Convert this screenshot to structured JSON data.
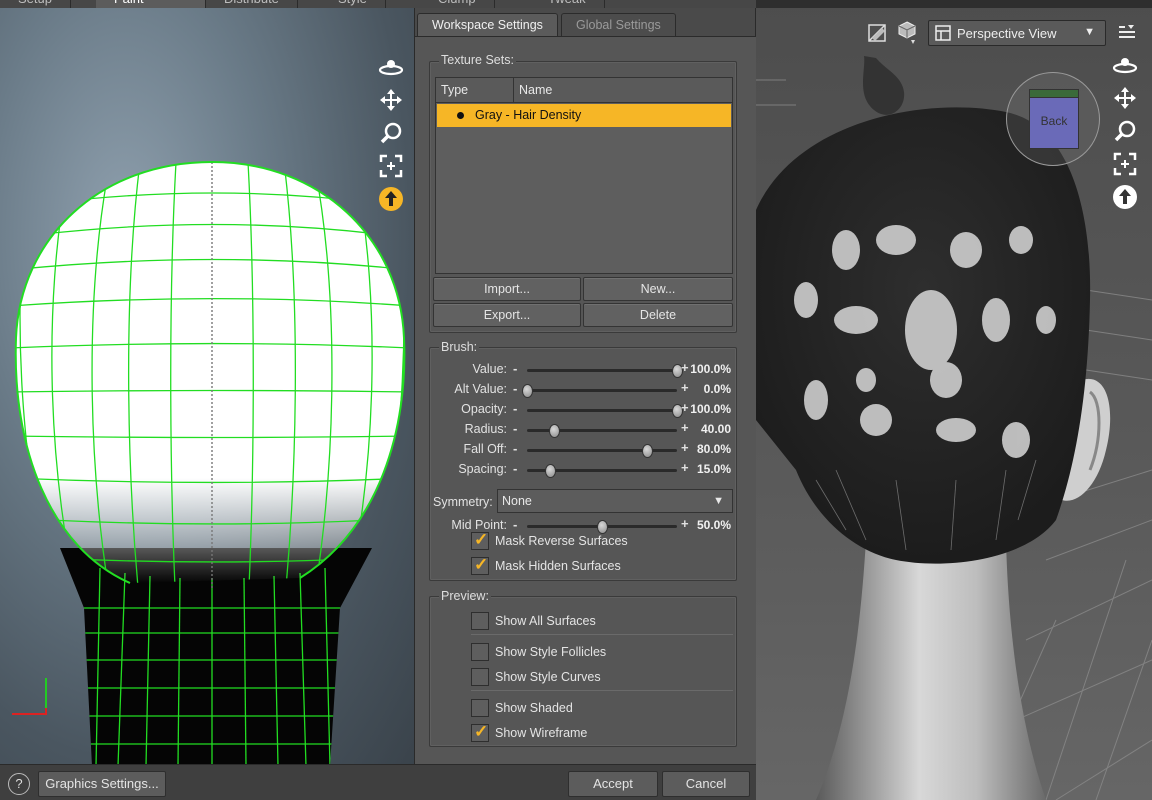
{
  "top_tabs": [
    "Setup",
    "Paint",
    "Distribute",
    "Style",
    "Clump",
    "Tweak"
  ],
  "panel": {
    "tabs": [
      "Workspace Settings",
      "Global Settings"
    ],
    "texture_sets": {
      "title": "Texture Sets:",
      "columns": [
        "Type",
        "Name"
      ],
      "rows": [
        {
          "name": "Gray - Hair Density"
        }
      ],
      "buttons": {
        "import": "Import...",
        "new": "New...",
        "export": "Export...",
        "delete": "Delete"
      }
    },
    "brush": {
      "title": "Brush:",
      "sliders": [
        {
          "label": "Value:",
          "value": "100.0%",
          "position": 1.0
        },
        {
          "label": "Alt Value:",
          "value": "0.0%",
          "position": 0.0
        },
        {
          "label": "Opacity:",
          "value": "100.0%",
          "position": 1.0
        },
        {
          "label": "Radius:",
          "value": "40.00",
          "position": 0.18
        },
        {
          "label": "Fall Off:",
          "value": "80.0%",
          "position": 0.8
        },
        {
          "label": "Spacing:",
          "value": "15.0%",
          "position": 0.15
        }
      ],
      "symmetry_label": "Symmetry:",
      "symmetry_value": "None",
      "midpoint": {
        "label": "Mid Point:",
        "value": "50.0%",
        "position": 0.5
      },
      "mask_reverse": "Mask Reverse Surfaces",
      "mask_hidden": "Mask Hidden Surfaces"
    },
    "preview": {
      "title": "Preview:",
      "show_all": "Show All Surfaces",
      "show_follicles": "Show Style Follicles",
      "show_curves": "Show Style Curves",
      "show_shaded": "Show Shaded",
      "show_wireframe": "Show Wireframe"
    }
  },
  "bottom": {
    "help": "?",
    "graphics": "Graphics Settings...",
    "accept": "Accept",
    "cancel": "Cancel"
  },
  "viewport": {
    "view_mode": "Perspective View",
    "cube_face": "Back"
  },
  "colors": {
    "accent": "#f6b626",
    "wire": "#22dd22"
  }
}
